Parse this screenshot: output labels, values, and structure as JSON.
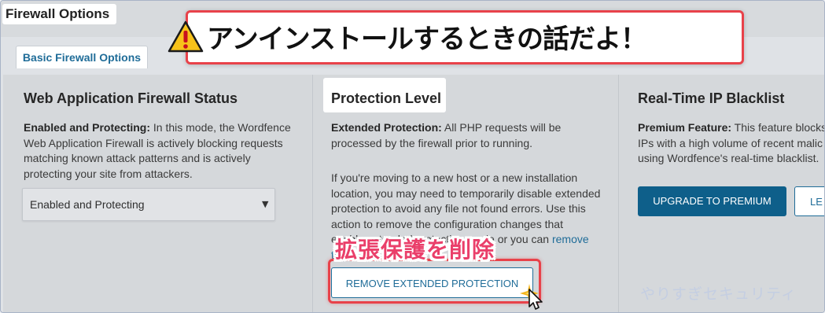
{
  "header": {
    "page_title": "Firewall Options",
    "tab_basic": "Basic Firewall Options"
  },
  "annotations": {
    "headline": "アンインストールするときの話だよ！",
    "remove_label": "拡張保護を削除",
    "watermark": "やりすぎセキュリティ"
  },
  "waf_status": {
    "title": "Web Application Firewall Status",
    "desc_bold": "Enabled and Protecting:",
    "desc_line1": " In this mode, the Wordfence",
    "desc_line2": "Web Application Firewall is actively blocking requests",
    "desc_line3": "matching known attack patterns and is actively",
    "desc_line4": "protecting your site from attackers.",
    "select_value": "Enabled and Protecting"
  },
  "protection_level": {
    "title": "Protection Level",
    "desc_bold": "Extended Protection:",
    "desc_line1": " All PHP requests will be",
    "desc_line2": "processed by the firewall prior to running.",
    "note_line1": "If you're moving to a new host or a new installation",
    "note_line2": "location, you may need to temporarily disable extended",
    "note_line3": "protection to avoid any file not found errors. Use this",
    "note_line4": "action to remove the configuration changes that",
    "note_line5": "enable extended protection mode or you can ",
    "note_link1": "remove",
    "note_line6_link": "the",
    "remove_button": "REMOVE EXTENDED PROTECTION"
  },
  "blacklist": {
    "title": "Real-Time IP Blacklist",
    "desc_bold": "Premium Feature:",
    "desc_line1": " This feature blocks",
    "desc_line2": "IPs with a high volume of recent malic",
    "desc_line3": "using Wordfence's real-time blacklist.",
    "upgrade_button": "UPGRADE TO PREMIUM",
    "learn_button": "LE"
  },
  "colors": {
    "accent": "#1f6c98",
    "primary_button": "#0e5f8a",
    "callout_red": "#e8424a",
    "callout_label_pink": "#ea3f6a",
    "warning_yellow": "#f7c21a"
  },
  "icons": [
    "warning-icon",
    "chevron-down-icon",
    "sparkle-icon",
    "cursor-icon"
  ]
}
